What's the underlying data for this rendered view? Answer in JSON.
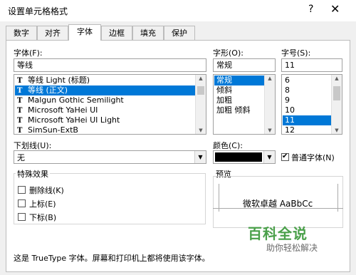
{
  "window": {
    "title": "设置单元格格式",
    "help_icon": "?",
    "close_icon": "✕"
  },
  "tabs": [
    {
      "label": "数字"
    },
    {
      "label": "对齐"
    },
    {
      "label": "字体"
    },
    {
      "label": "边框"
    },
    {
      "label": "填充"
    },
    {
      "label": "保护"
    }
  ],
  "font": {
    "label": "字体(F):",
    "value": "等线",
    "list": [
      "等线 Light (标题)",
      "等线 (正文)",
      "Malgun Gothic Semilight",
      "Microsoft YaHei UI",
      "Microsoft YaHei UI Light",
      "SimSun-ExtB"
    ]
  },
  "style": {
    "label": "字形(O):",
    "value": "常规",
    "list": [
      "常规",
      "倾斜",
      "加粗",
      "加粗 倾斜"
    ]
  },
  "size": {
    "label": "字号(S):",
    "value": "11",
    "list": [
      "6",
      "8",
      "9",
      "10",
      "11",
      "12"
    ]
  },
  "underline": {
    "label": "下划线(U):",
    "value": "无"
  },
  "color": {
    "label": "颜色(C):",
    "value": "#000000"
  },
  "normal_font": {
    "label": "普通字体(N)",
    "checked": true
  },
  "effects": {
    "label": "特殊效果",
    "items": [
      {
        "label": "删除线(K)"
      },
      {
        "label": "上标(E)"
      },
      {
        "label": "下标(B)"
      }
    ]
  },
  "preview": {
    "label": "预览",
    "sample": "微软卓越  AaBbCc"
  },
  "note": "这是 TrueType 字体。屏幕和打印机上都将使用该字体。",
  "watermark": {
    "title": "百科全说",
    "subtitle": "助你轻松解决"
  },
  "colors": {
    "selection": "#0078d7",
    "watermark": "#4aa04a"
  }
}
